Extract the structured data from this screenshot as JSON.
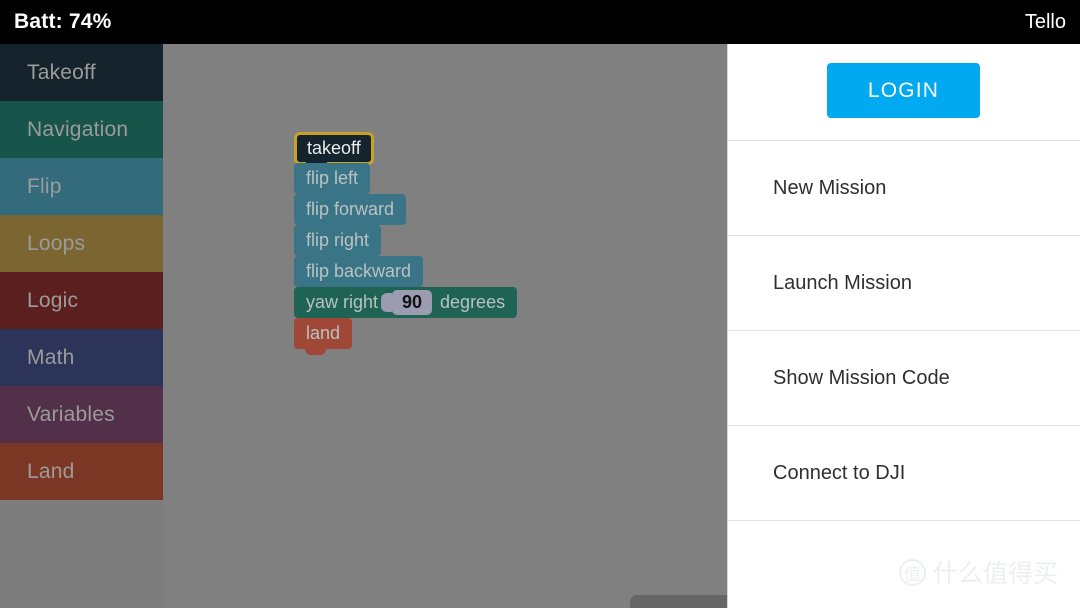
{
  "status_bar": {
    "battery_label": "Batt: 74%",
    "battery_percent": 74,
    "device_name": "Tello"
  },
  "sidebar": {
    "categories": [
      {
        "label": "Takeoff",
        "color": "#14232c"
      },
      {
        "label": "Navigation",
        "color": "#17544a"
      },
      {
        "label": "Flip",
        "color": "#336a7c"
      },
      {
        "label": "Loops",
        "color": "#7b6631"
      },
      {
        "label": "Logic",
        "color": "#5c1f1f"
      },
      {
        "label": "Math",
        "color": "#2c3459"
      },
      {
        "label": "Variables",
        "color": "#53304a"
      },
      {
        "label": "Land",
        "color": "#7c3724"
      }
    ]
  },
  "canvas": {
    "program_blocks": [
      {
        "label": "takeoff",
        "type": "takeoff",
        "selected": true,
        "indent": 0
      },
      {
        "label": "flip left",
        "type": "flip",
        "selected": false,
        "indent": 0
      },
      {
        "label": "flip forward",
        "type": "flip",
        "selected": false,
        "indent": 0
      },
      {
        "label": "flip right",
        "type": "flip",
        "selected": false,
        "indent": 0
      },
      {
        "label": "flip backward",
        "type": "flip",
        "selected": false,
        "indent": 0
      }
    ],
    "yaw_block": {
      "prefix": "yaw right",
      "value": "90",
      "suffix": "degrees"
    },
    "land_block": {
      "label": "land"
    },
    "scrollbar": {
      "orientation": "horizontal"
    }
  },
  "right_panel": {
    "login_label": "LOGIN",
    "menu_items": [
      {
        "label": "New Mission"
      },
      {
        "label": "Launch Mission"
      },
      {
        "label": "Show Mission Code"
      },
      {
        "label": "Connect to DJI"
      }
    ]
  },
  "watermark": {
    "mark": "值",
    "text": "什么值得买"
  }
}
